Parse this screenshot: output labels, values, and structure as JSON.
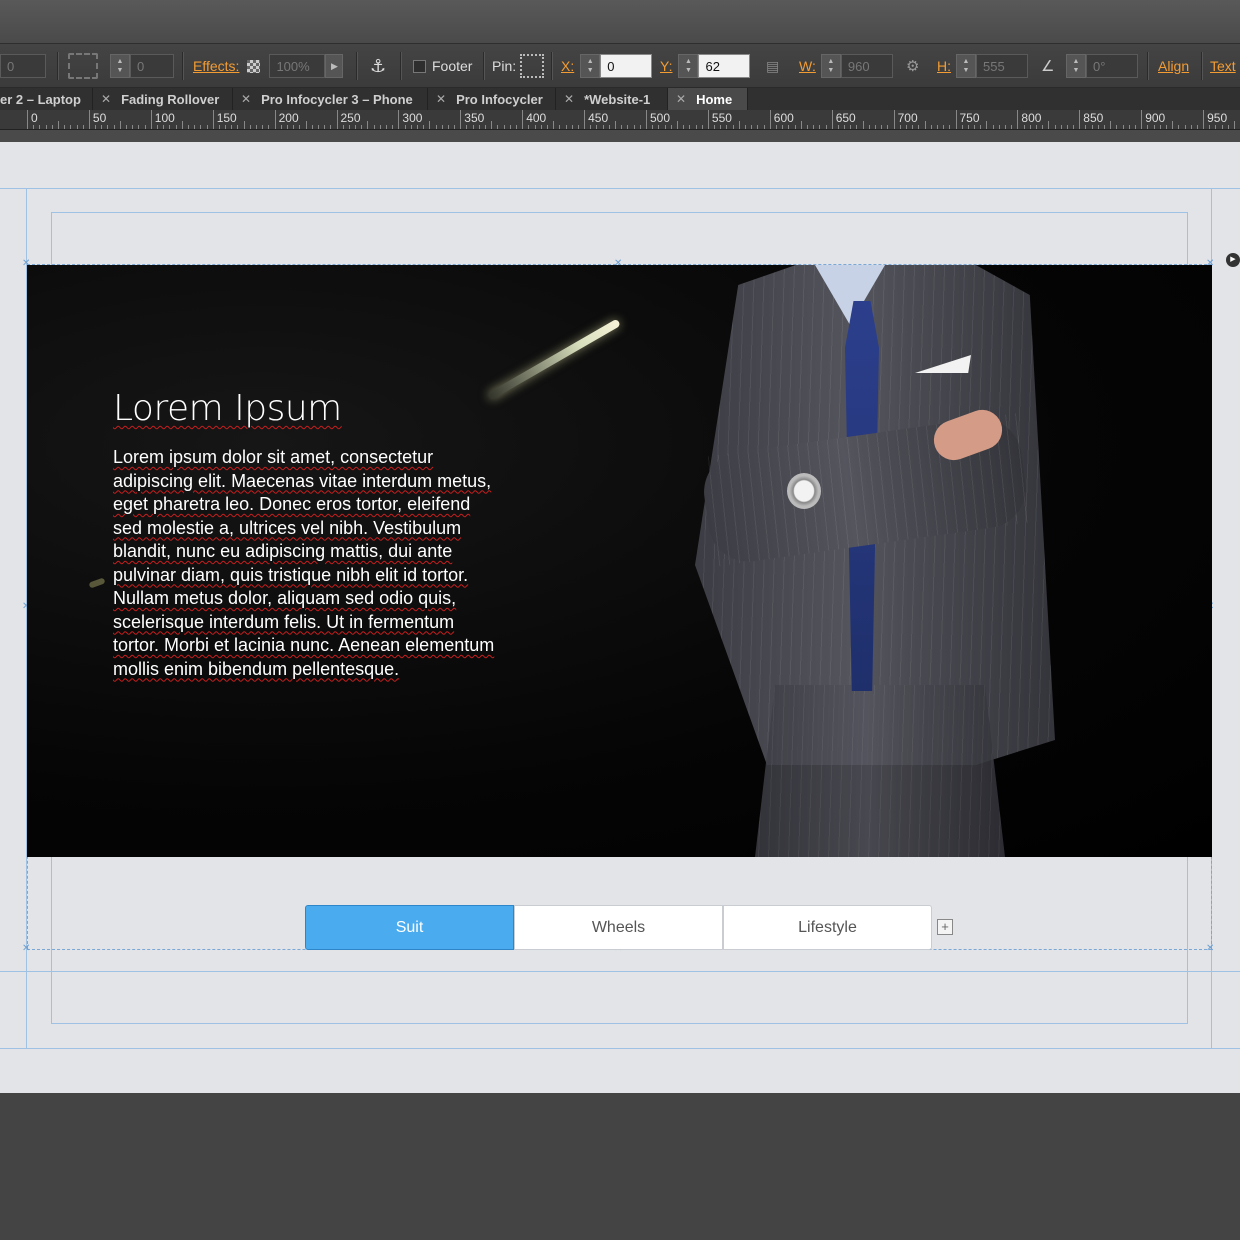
{
  "control_bar": {
    "field_left_value": "0",
    "field_rotate_value": "0",
    "effects_label": "Effects:",
    "effects_value": "100%",
    "footer_label": "Footer",
    "pin_label": "Pin:",
    "x_label": "X:",
    "x_value": "0",
    "y_label": "Y:",
    "y_value": "62",
    "w_label": "W:",
    "w_value": "960",
    "h_label": "H:",
    "h_value": "555",
    "angle_value": "0°",
    "align_label": "Align",
    "text_label": "Text"
  },
  "tabs": [
    {
      "label": "er 2 – Laptop",
      "active": false,
      "closable": false
    },
    {
      "label": "Fading Rollover",
      "active": false,
      "closable": true
    },
    {
      "label": "Pro Infocycler 3 – Phone",
      "active": false,
      "closable": true
    },
    {
      "label": "Pro Infocycler",
      "active": false,
      "closable": true
    },
    {
      "label": "*Website-1",
      "active": false,
      "closable": true
    },
    {
      "label": "Home",
      "active": true,
      "closable": true
    }
  ],
  "ruler": {
    "labels": [
      "0",
      "50",
      "100",
      "150",
      "200",
      "250",
      "300",
      "350",
      "400",
      "450",
      "500",
      "550",
      "600",
      "650",
      "700",
      "750",
      "800",
      "850",
      "900",
      "950"
    ]
  },
  "hero": {
    "title": "Lorem Ipsum",
    "body": "Lorem ipsum dolor sit amet, consectetur adipiscing elit. Maecenas vitae interdum metus, eget pharetra leo. Donec eros tortor, eleifend sed molestie a, ultrices vel nibh. Vestibulum blandit, nunc eu adipiscing mattis, dui ante pulvinar diam, quis tristique nibh elit id tortor. Nullam metus dolor, aliquam sed odio quis, scelerisque interdum felis. Ut in fermentum tortor. Morbi et lacinia nunc. Aenean elementum mollis enim bibendum pellentesque."
  },
  "tab_widget": {
    "buttons": [
      {
        "label": "Suit",
        "active": true
      },
      {
        "label": "Wheels",
        "active": false
      },
      {
        "label": "Lifestyle",
        "active": false
      }
    ],
    "add_icon": "+"
  },
  "colors": {
    "accent_orange": "#f39c33",
    "tab_active_blue": "#4aacef",
    "guide_blue": "#7aa7d6",
    "spellcheck_red": "#c81e1e"
  }
}
